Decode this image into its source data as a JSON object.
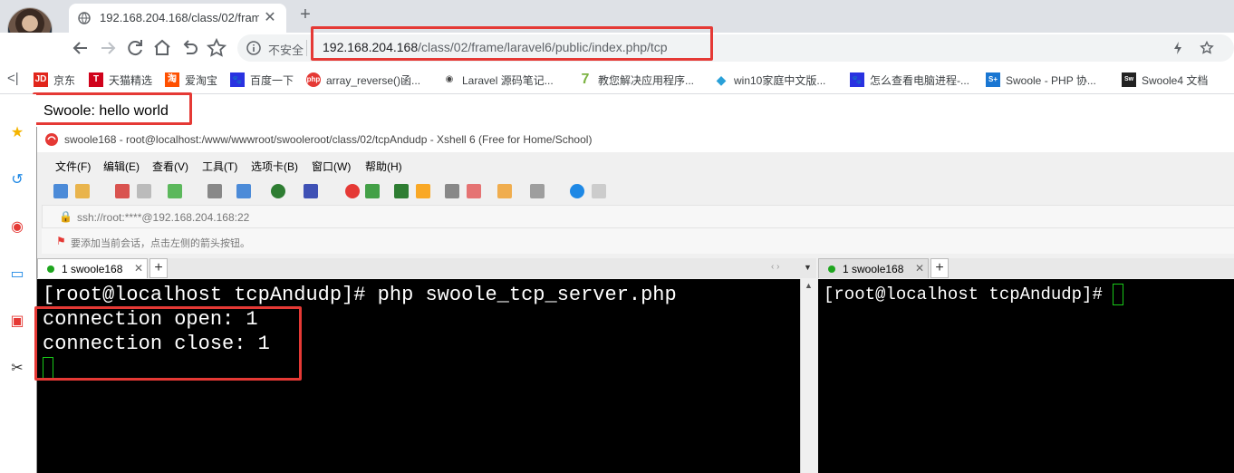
{
  "browser": {
    "tab_title": "192.168.204.168/class/02/fram",
    "close_glyph": "✕",
    "newtab_glyph": "+",
    "omnibox": {
      "security_label": "不安全",
      "url_host": "192.168.204.168",
      "url_path": "/class/02/frame/laravel6/public/index.php/tcp"
    },
    "nav_icons": [
      "back-icon",
      "forward-icon",
      "reload-icon",
      "home-icon",
      "undo-icon",
      "star-icon"
    ],
    "right_icons": [
      "extension-icon",
      "bookmark-star-icon"
    ]
  },
  "bookmarks": [
    {
      "label": "京东",
      "icon": "JD",
      "color": "#e1251b"
    },
    {
      "label": "天猫精选",
      "icon": "T",
      "color": "#d0021b"
    },
    {
      "label": "爱淘宝",
      "icon": "淘",
      "color": "#ff5000"
    },
    {
      "label": "百度一下",
      "icon": "🐾",
      "color": "#2932e1"
    },
    {
      "label": "array_reverse()函...",
      "icon": "php",
      "color": "#e53935"
    },
    {
      "label": "Laravel 源码笔记...",
      "icon": "◉",
      "color": "#444"
    },
    {
      "label": "教您解决应用程序...",
      "icon": "7",
      "color": "#7cb342"
    },
    {
      "label": "win10家庭中文版...",
      "icon": "◆",
      "color": "#29a0d8"
    },
    {
      "label": "怎么查看电脑进程-...",
      "icon": "🐾",
      "color": "#2932e1"
    },
    {
      "label": "Swoole - PHP 协...",
      "icon": "S+",
      "color": "#1976d2"
    },
    {
      "label": "Swoole4 文档",
      "icon": "Sw",
      "color": "#222"
    }
  ],
  "page": {
    "body_text": "Swoole: hello world"
  },
  "xshell": {
    "window_title": "swoole168 - root@localhost:/www/wwwroot/swooleroot/class/02/tcpAndudp - Xshell 6 (Free for Home/School)",
    "menus": [
      "文件(F)",
      "编辑(E)",
      "查看(V)",
      "工具(T)",
      "选项卡(B)",
      "窗口(W)",
      "帮助(H)"
    ],
    "address": "ssh://root:****@192.168.204.168:22",
    "note": "要添加当前会话，点击左侧的箭头按钮。",
    "left_tab_label": "1 swoole168",
    "right_tab_label": "1 swoole168",
    "left_terminal": {
      "line1": "[root@localhost tcpAndudp]# php swoole_tcp_server.php",
      "line2": "connection open: 1",
      "line3": "connection close: 1"
    },
    "right_terminal": {
      "line1": "[root@localhost tcpAndudp]# "
    }
  },
  "colors": {
    "highlight": "#e53935",
    "cursor": "#18c818",
    "terminal_bg": "#000000"
  }
}
